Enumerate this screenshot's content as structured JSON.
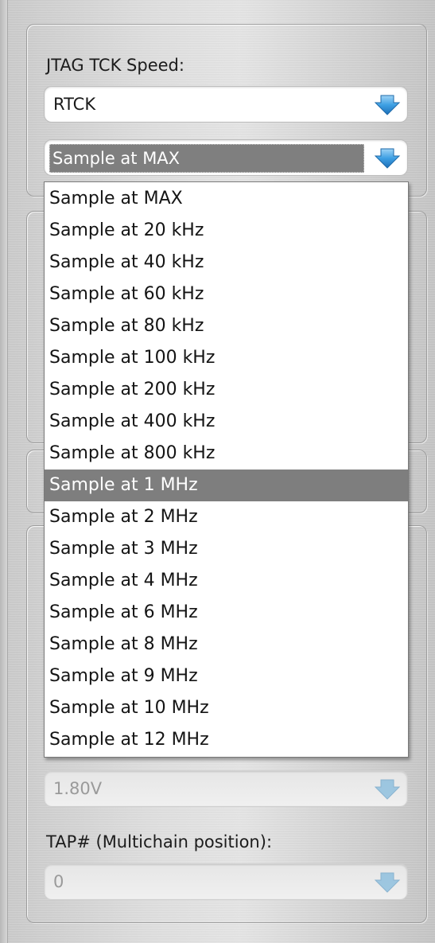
{
  "colors": {
    "accent_arrow": "#3d9fe3",
    "selection_bg": "#7e7e7e",
    "panel_border": "#9c9c9c"
  },
  "jtag": {
    "label": "JTAG TCK Speed:",
    "speed_value": "RTCK",
    "sample_value": "Sample at MAX",
    "arrow_icon": "blue-down-arrow"
  },
  "sample_list": {
    "highlighted_index": 9,
    "items": [
      "Sample at MAX",
      "Sample at 20 kHz",
      "Sample at 40 kHz",
      "Sample at 60 kHz",
      "Sample at 80 kHz",
      "Sample at 100 kHz",
      "Sample at 200 kHz",
      "Sample at 400 kHz",
      "Sample at 800 kHz",
      "Sample at 1 MHz",
      "Sample at 2 MHz",
      "Sample at 3 MHz",
      "Sample at 4 MHz",
      "Sample at 6 MHz",
      "Sample at 8 MHz",
      "Sample at 9 MHz",
      "Sample at 10 MHz",
      "Sample at 12 MHz"
    ]
  },
  "voltage": {
    "value": "1.80V"
  },
  "tap": {
    "label": "TAP# (Multichain position):",
    "value": "0"
  }
}
